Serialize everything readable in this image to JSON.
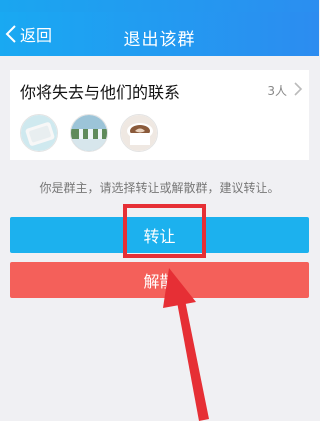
{
  "header": {
    "back_label": "返回",
    "title": "退出该群"
  },
  "card": {
    "title": "你将失去与他们的联系",
    "member_count": "3人",
    "avatars": [
      "tray-image",
      "waterfall-image",
      "coffee-cup-image"
    ]
  },
  "hint": "你是群主，请选择转让或解散群，建议转让。",
  "buttons": {
    "transfer_label": "转让",
    "dissolve_label": "解散"
  },
  "colors": {
    "header_start": "#19a9f2",
    "header_end": "#2c8cf0",
    "transfer": "#1cb1ee",
    "dissolve": "#f4605a",
    "annotation": "#e62f35"
  },
  "icons": {
    "back": "chevron-left-icon",
    "card_arrow": "chevron-right-icon"
  }
}
